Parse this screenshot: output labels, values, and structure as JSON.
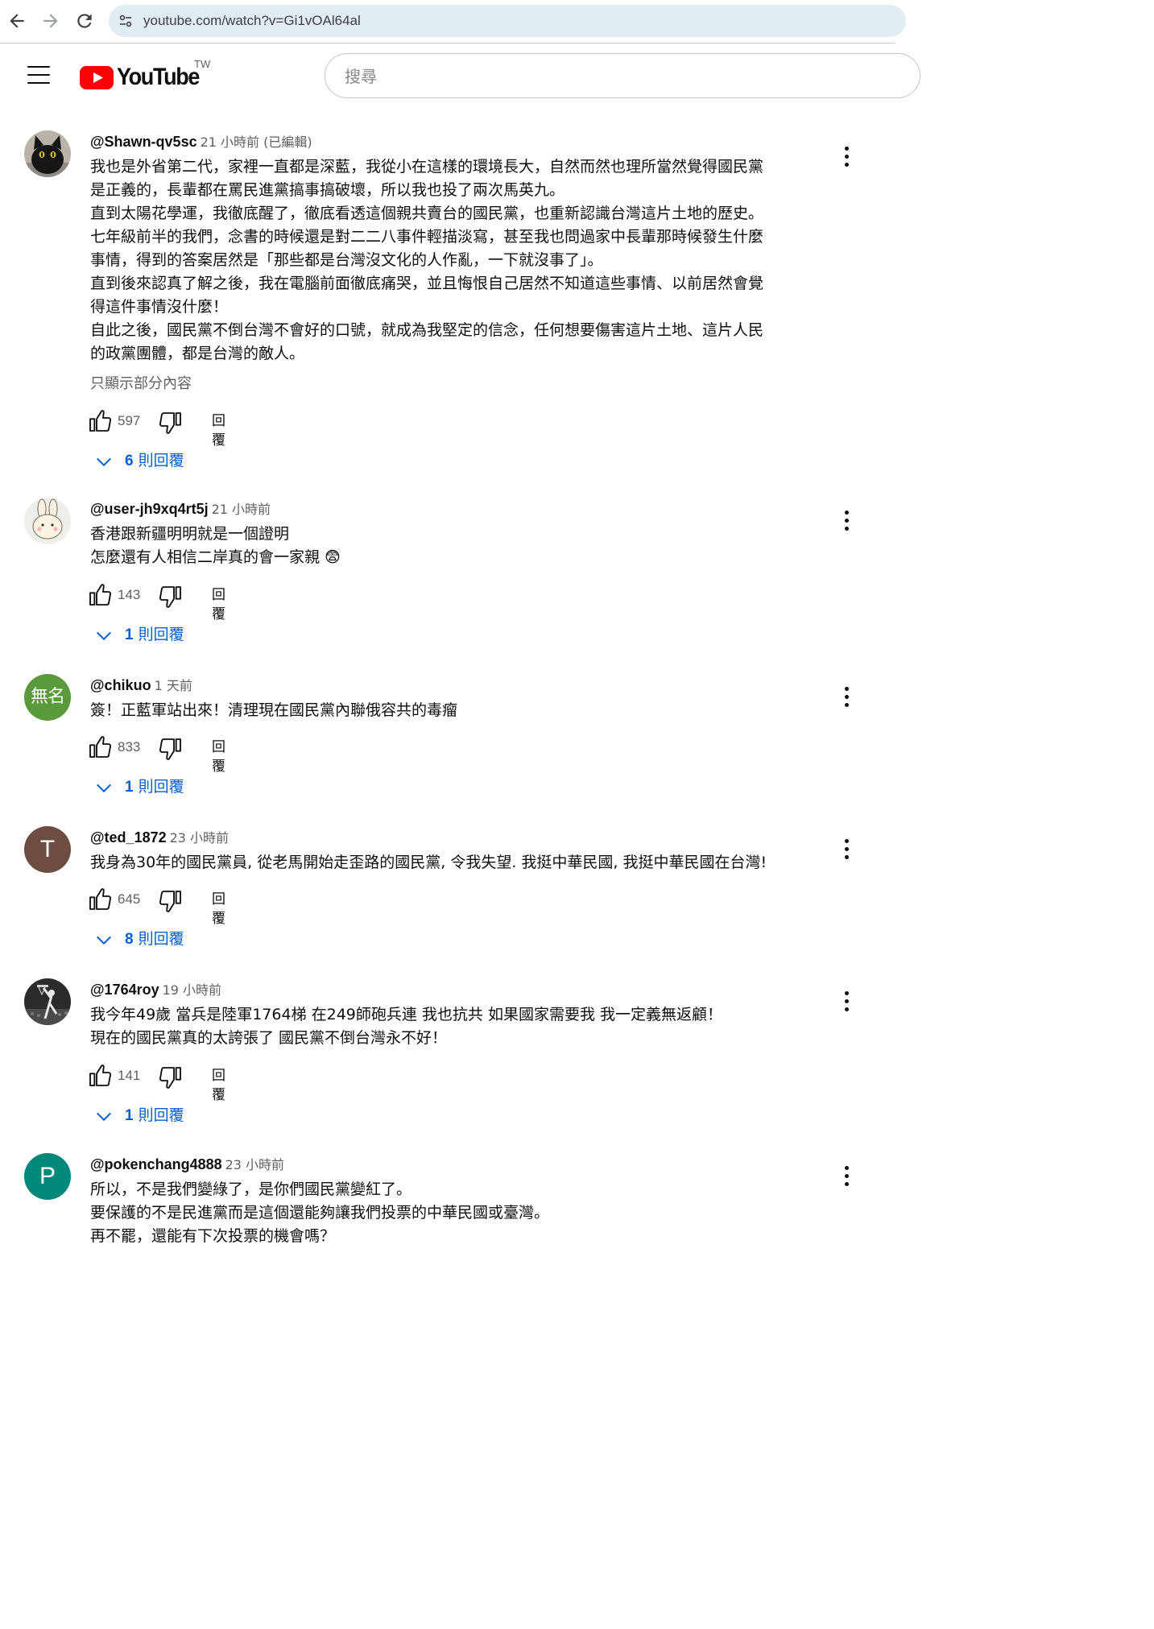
{
  "browser": {
    "url": "youtube.com/watch?v=Gi1vOAl64al"
  },
  "header": {
    "logo_text": "YouTube",
    "region": "TW",
    "search_placeholder": "搜尋"
  },
  "labels": {
    "reply": "回覆",
    "replies_suffix": "則回覆",
    "show_less": "只顯示部分內容"
  },
  "colors": {
    "link_blue": "#065fd4",
    "brand_red": "#ff0000"
  },
  "comments": [
    {
      "author": "@Shawn-qv5sc",
      "time": "21 小時前 (已編輯)",
      "avatar": "black-cat-photo",
      "lines": [
        "我也是外省第二代，家裡一直都是深藍，我從小在這樣的環境長大，自然而然也理所當然覺得國民黨",
        "是正義的，長輩都在罵民進黨搞事搞破壞，所以我也投了兩次馬英九。",
        "直到太陽花學運，我徹底醒了，徹底看透這個親共賣台的國民黨，也重新認識台灣這片土地的歷史。",
        "七年級前半的我們，念書的時候還是對二二八事件輕描淡寫，甚至我也問過家中長輩那時候發生什麼",
        "事情，得到的答案居然是「那些都是台灣沒文化的人作亂，一下就沒事了」。",
        "直到後來認真了解之後，我在電腦前面徹底痛哭，並且悔恨自己居然不知道這些事情、以前居然會覺",
        "得這件事情沒什麼！",
        "自此之後，國民黨不倒台灣不會好的口號，就成為我堅定的信念，任何想要傷害這片土地、這片人民",
        "的政黨團體，都是台灣的敵人。"
      ],
      "likes": "597",
      "reply_count": "6"
    },
    {
      "author": "@user-jh9xq4rt5j",
      "time": "21 小時前",
      "avatar": "bunny-illustration",
      "lines": [
        "香港跟新疆明明就是一個證明",
        "怎麼還有人相信二岸真的會一家親 😨"
      ],
      "likes": "143",
      "reply_count": "1"
    },
    {
      "author": "@chikuo",
      "time": "1 天前",
      "avatar": "無名",
      "avatar_color": "#5b9a3b",
      "lines": [
        "簽！正藍軍站出來！清理現在國民黨內聯俄容共的毒瘤"
      ],
      "likes": "833",
      "reply_count": "1"
    },
    {
      "author": "@ted_1872",
      "time": "23 小時前",
      "avatar": "T",
      "avatar_color": "#6d4c41",
      "lines": [
        "我身為30年的國民黨員, 從老馬開始走歪路的國民黨, 令我失望.  我挺中華民國, 我挺中華民國在台灣!"
      ],
      "likes": "645",
      "reply_count": "8"
    },
    {
      "author": "@1764roy",
      "time": "19 小時前",
      "avatar": "basketball-dunk-photo",
      "lines": [
        "我今年49歲 當兵是陸軍1764梯 在249師砲兵連 我也抗共 如果國家需要我 我一定義無返顧！",
        "現在的國民黨真的太誇張了 國民黨不倒台灣永不好！"
      ],
      "likes": "141",
      "reply_count": "1"
    },
    {
      "author": "@pokenchang4888",
      "time": "23 小時前",
      "avatar": "P",
      "avatar_color": "#00897b",
      "lines": [
        "所以，不是我們變綠了，是你們國民黨變紅了。",
        "要保護的不是民進黨而是這個還能夠讓我們投票的中華民國或臺灣。",
        "再不罷，還能有下次投票的機會嗎？"
      ]
    }
  ]
}
